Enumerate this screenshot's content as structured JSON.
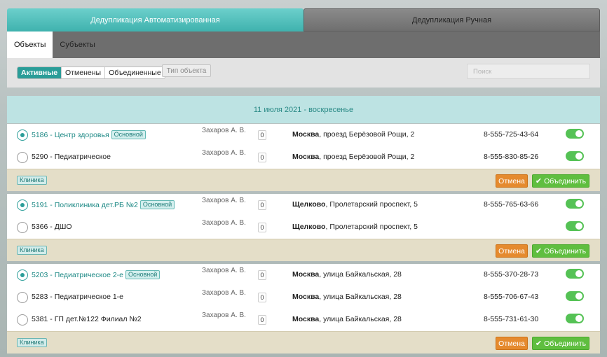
{
  "tabs": {
    "auto": "Дедупликация Автоматизированная",
    "manual": "Дедупликация Ручная"
  },
  "subtabs": {
    "objects": "Объекты",
    "subjects": "Субъекты"
  },
  "filters": {
    "active": "Активные",
    "cancelled": "Отменены",
    "merged": "Объединенные",
    "object_type": "Тип объекта",
    "search_placeholder": "Поиск"
  },
  "date_header": "11 июля 2021 - воскресенье",
  "main_badge": "Основной",
  "buttons": {
    "cancel": "Отмена",
    "merge": "Объединить"
  },
  "groups": [
    {
      "tag": "Клиника",
      "rows": [
        {
          "name": "5186 - Центр здоровья",
          "main": true,
          "person": "Захаров А. В.",
          "count": "0",
          "city": "Москва",
          "street": ", проезд Берёзовой Рощи, 2",
          "phone": "8-555-725-43-64"
        },
        {
          "name": "5290 - Педиатрическое",
          "main": false,
          "person": "Захаров А. В.",
          "count": "0",
          "city": "Москва",
          "street": ", проезд Берёзовой Рощи, 2",
          "phone": "8-555-830-85-26"
        }
      ]
    },
    {
      "tag": "Клиника",
      "rows": [
        {
          "name": "5191 - Поликлиника дет.РБ №2",
          "main": true,
          "person": "Захаров А. В.",
          "count": "0",
          "city": "Щелково",
          "street": ", Пролетарский проспект, 5",
          "phone": "8-555-765-63-66"
        },
        {
          "name": "5366 - ДШО",
          "main": false,
          "person": "Захаров А. В.",
          "count": "0",
          "city": "Щелково",
          "street": ", Пролетарский проспект, 5",
          "phone": ""
        }
      ]
    },
    {
      "tag": "Клиника",
      "rows": [
        {
          "name": "5203 - Педиатрическое 2-е",
          "main": true,
          "person": "Захаров А. В.",
          "count": "0",
          "city": "Москва",
          "street": ", улица Байкальская, 28",
          "phone": "8-555-370-28-73"
        },
        {
          "name": "5283 - Педиатрическое 1-е",
          "main": false,
          "person": "Захаров А. В.",
          "count": "0",
          "city": "Москва",
          "street": ", улица Байкальская, 28",
          "phone": "8-555-706-67-43"
        },
        {
          "name": "5381 - ГП дет.№122 Филиал №2",
          "main": false,
          "person": "Захаров А. В.",
          "count": "0",
          "city": "Москва",
          "street": ", улица Байкальская, 28",
          "phone": "8-555-731-61-30"
        }
      ]
    }
  ]
}
